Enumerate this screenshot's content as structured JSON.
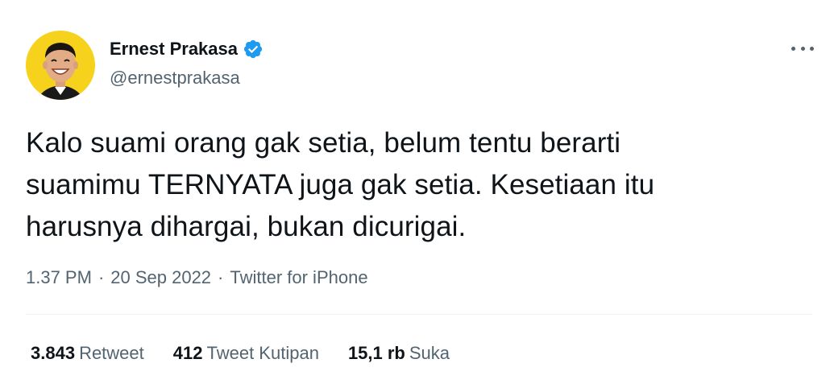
{
  "author": {
    "display_name": "Ernest Prakasa",
    "handle": "@ernestprakasa",
    "verified": true,
    "verified_color": "#1d9bf0",
    "avatar_background": "#f7d21d"
  },
  "tweet": {
    "lines": [
      "Kalo suami orang gak setia, belum tentu berarti",
      "suamimu TERNYATA juga gak setia. Kesetiaan itu",
      "harusnya dihargai, bukan dicurigai."
    ],
    "time": "1.37 PM",
    "date": "20 Sep 2022",
    "source": "Twitter for iPhone",
    "separator": "·"
  },
  "stats": {
    "retweets": {
      "count": "3.843",
      "label": "Retweet"
    },
    "quotes": {
      "count": "412",
      "label": "Tweet Kutipan"
    },
    "likes": {
      "count": "15,1 rb",
      "label": "Suka"
    }
  },
  "icons": {
    "more": "more-options-icon",
    "verified": "verified-badge-icon"
  }
}
